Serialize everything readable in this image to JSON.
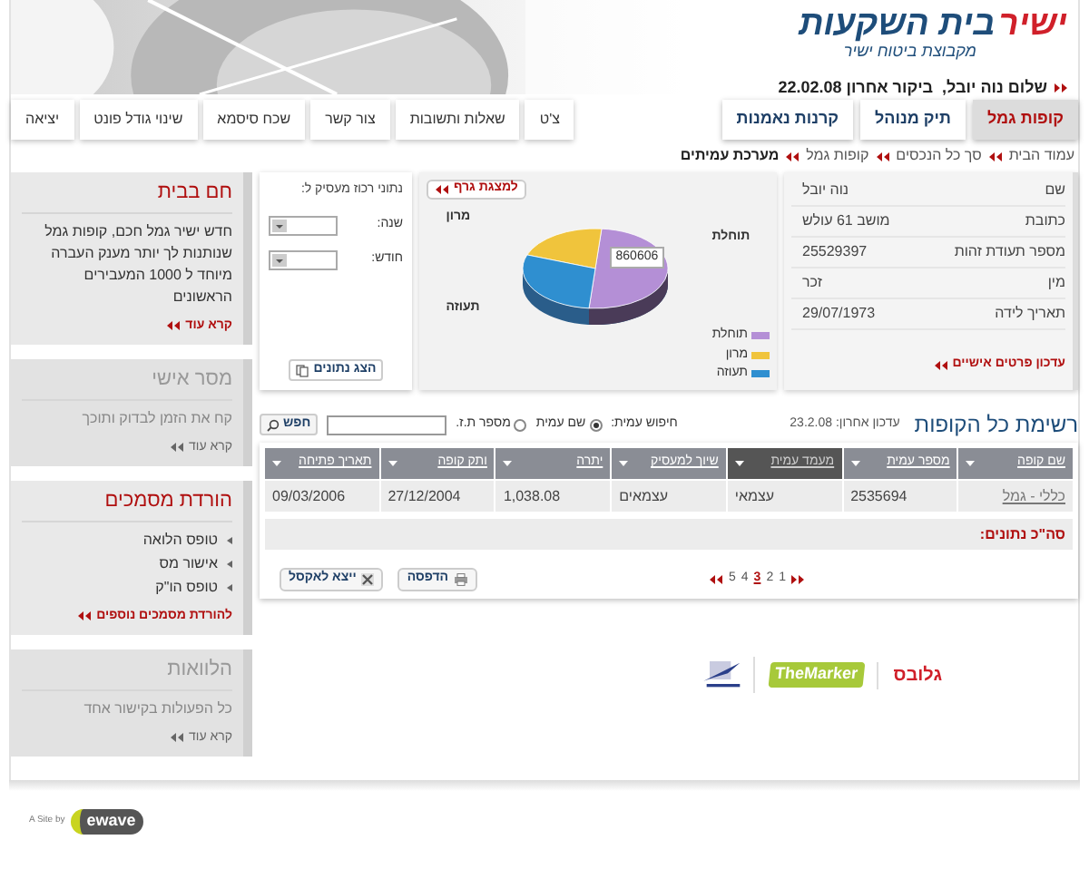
{
  "header": {
    "logo_brand": "ישיר",
    "logo_name": "בית השקעות",
    "logo_tagline": "מקבוצת ביטוח ישיר",
    "greeting": "שלום נוה יובל,  ביקור אחרון 22.02.08"
  },
  "main_tabs": [
    {
      "label": "קופות גמל",
      "selected": true
    },
    {
      "label": "תיק מנוהל",
      "selected": false
    },
    {
      "label": "קרנות נאמנות",
      "selected": false
    }
  ],
  "utility_links": [
    "צ'ט",
    "שאלות ותשובות",
    "צור קשר",
    "שכח סיסמא",
    "שינוי גודל פונט",
    "יציאה"
  ],
  "breadcrumb": [
    {
      "label": "עמוד הבית",
      "current": false
    },
    {
      "label": "סך כל הנכסים",
      "current": false
    },
    {
      "label": "קופות גמל",
      "current": false
    },
    {
      "label": "מערכת עמיתים",
      "current": true
    }
  ],
  "personal_details": {
    "fields": [
      {
        "label": "שם",
        "value": "נוה יובל"
      },
      {
        "label": "כתובת",
        "value": "מושב 61 עולש"
      },
      {
        "label": "מספר תעודת זהות",
        "value": "25529397"
      },
      {
        "label": "מין",
        "value": "זכר"
      },
      {
        "label": "תאריך לידה",
        "value": "29/07/1973"
      }
    ],
    "link": "עדכון פרטים אישיים"
  },
  "chart_panel": {
    "button": "למצגת גרף",
    "tooltip": "860606",
    "slice_labels": [
      "תוחלת",
      "מרון",
      "תעוזה"
    ],
    "legend": [
      {
        "label": "תוחלת",
        "color": "#b48fd6"
      },
      {
        "label": "מרון",
        "color": "#f0c43c"
      },
      {
        "label": "תעוזה",
        "color": "#2f8fd0"
      }
    ]
  },
  "employer_form": {
    "title": "נתוני רכוז מעסיק ל:",
    "fields": [
      {
        "label": "שנה:"
      },
      {
        "label": "חודש:"
      }
    ],
    "button": "הצג נתונים"
  },
  "sidebar": [
    {
      "kind": "promo",
      "title": "חם בבית",
      "items": [
        "חדש ישיר גמל חכם, קופות גמל שנותנות לך יותר מענק העברה מיוחד ל 1000 המעבירים הראשונים"
      ],
      "link": "קרא עוד"
    },
    {
      "kind": "muted",
      "title": "מסר אישי",
      "items": [
        "קח את הזמן לבדוק ותוכך"
      ],
      "link": "קרא עוד"
    },
    {
      "kind": "list",
      "title": "הורדת מסמכים",
      "items": [
        "טופס הלואה",
        "אישור מס",
        "טופס הו\"ק"
      ],
      "link": "להורדת מסמכים נוספים"
    },
    {
      "kind": "muted",
      "title": "הלוואות",
      "items": [
        "כל הפעולות בקישור אחד"
      ],
      "link": "קרא עוד"
    }
  ],
  "funds": {
    "title": "רשימת כל הקופות",
    "updated": "עדכון אחרון: 23.2.08",
    "search": {
      "label": "חיפוש עמית:",
      "options": [
        {
          "label": "שם עמית",
          "selected": true
        },
        {
          "label": "מספר ת.ז.",
          "selected": false
        }
      ],
      "button": "חפש"
    },
    "columns": [
      {
        "label": "שם קופה",
        "selected": false
      },
      {
        "label": "מספר עמית",
        "selected": false
      },
      {
        "label": "מעמד עמית",
        "selected": true
      },
      {
        "label": "שיוך למעסיק",
        "selected": false
      },
      {
        "label": "יתרה",
        "selected": false
      },
      {
        "label": "ותק קופה",
        "selected": false
      },
      {
        "label": "תאריך פתיחה",
        "selected": false
      }
    ],
    "rows": [
      [
        "כללי - גמל",
        "2535694",
        "עצמאי",
        "עצמאים",
        "1,038.08",
        "27/12/2004",
        "09/03/2006"
      ]
    ],
    "total_label": "סה\"כ נתונים:",
    "pages": [
      {
        "label": "1",
        "selected": false
      },
      {
        "label": "2",
        "selected": false
      },
      {
        "label": "3",
        "selected": true
      },
      {
        "label": "4",
        "selected": false
      },
      {
        "label": "5",
        "selected": false
      }
    ],
    "buttons": [
      "הדפסה",
      "ייצא לאקסל"
    ]
  },
  "partners": [
    "גלובס",
    "TheMarker"
  ],
  "footer": {
    "credit": "A Site by",
    "brand": "ewave"
  }
}
